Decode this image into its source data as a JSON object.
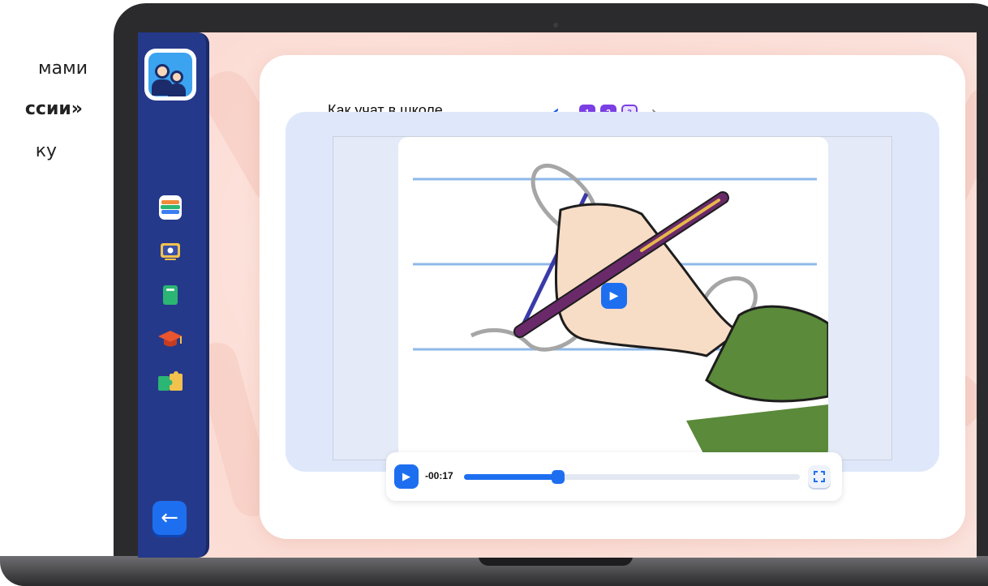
{
  "slide": {
    "line1": "мами",
    "line2": "ссии»",
    "line3": "ку"
  },
  "sidebar": {
    "items": [
      {
        "name": "books-icon"
      },
      {
        "name": "video-lesson-icon"
      },
      {
        "name": "notebook-icon"
      },
      {
        "name": "graduation-cap-icon"
      },
      {
        "name": "puzzle-icon"
      }
    ],
    "back_icon": "←"
  },
  "lesson": {
    "title": "Как учат в школе",
    "prev_icon": "‹",
    "next_icon": "›",
    "pages": [
      "1",
      "2",
      "3"
    ],
    "current_page": "3"
  },
  "video": {
    "play_icon": "▶",
    "time": "-00:17",
    "progress": 0.28
  },
  "colors": {
    "sidebar": "#25398a",
    "accent": "#1e6ff0",
    "pager": "#7b3fe4",
    "background": "#fbdcd4"
  }
}
